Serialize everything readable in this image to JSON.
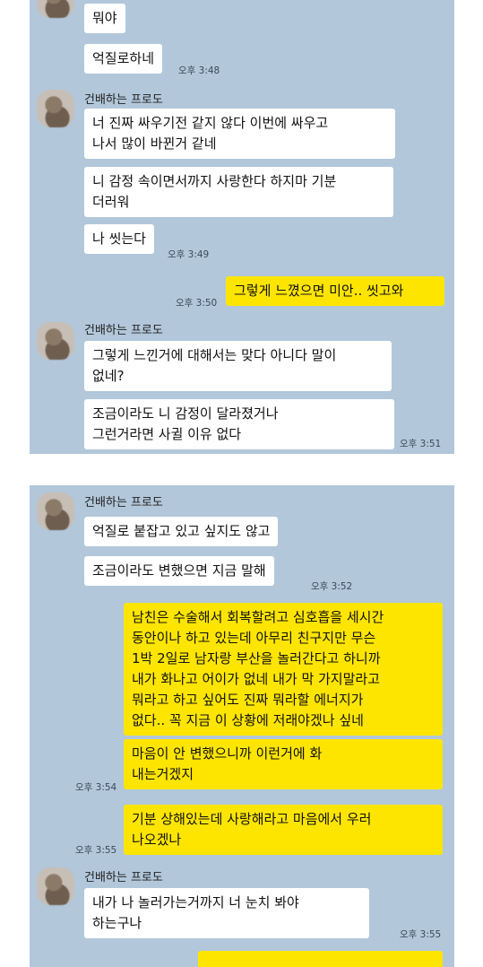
{
  "sender_name": "건배하는 프로도",
  "panel1": {
    "messages": [
      {
        "text": "뭐야",
        "side": "other"
      },
      {
        "text": "억질로하네",
        "side": "other",
        "time": "오후 3:48"
      },
      {
        "text": "너 진짜 싸우기전 같지 않다 이번에 싸우고\n나서 많이 바뀐거 같네",
        "side": "other"
      },
      {
        "text": "니 감정 속이면서까지 사랑한다 하지마 기분\n더러워",
        "side": "other"
      },
      {
        "text": "나 씻는다",
        "side": "other",
        "time": "오후 3:49"
      },
      {
        "text": "그렇게 느꼈으면 미안.. 씻고와",
        "side": "me",
        "time": "오후 3:50"
      },
      {
        "text": "그렇게 느낀거에 대해서는 맞다 아니다 말이\n없네?",
        "side": "other"
      },
      {
        "text": "조금이라도 니 감정이 달라졌거나\n그런거라면 사귈 이유 없다",
        "side": "other",
        "time": "오후 3:51"
      }
    ]
  },
  "panel2": {
    "messages": [
      {
        "text": "억질로 붙잡고 있고 싶지도 않고",
        "side": "other"
      },
      {
        "text": "조금이라도 변했으면 지금 말해",
        "side": "other",
        "time": "오후 3:52"
      },
      {
        "text": "남친은 수술해서 회복할려고 심호흡을 세시간\n동안이나 하고 있는데 아무리 친구지만 무슨\n1박 2일로 남자랑 부산을 놀러간다고 하니까\n내가 화나고 어이가 없네 내가 막 가지말라고\n뭐라고 하고 싶어도 진짜 뭐라할 에너지가\n없다.. 꼭 지금 이 상황에 저래야겠나 싶네",
        "side": "me"
      },
      {
        "text": "마음이 안 변했으니까 이런거에 화\n내는거겠지",
        "side": "me",
        "time": "오후 3:54"
      },
      {
        "text": "기분 상해있는데 사랑해라고 마음에서 우러\n나오겠나",
        "side": "me",
        "time": "오후 3:55"
      },
      {
        "text": "내가 나 놀러가는거까지 너 눈치 봐야\n하는구나",
        "side": "other",
        "time": "오후 3:55"
      }
    ]
  }
}
